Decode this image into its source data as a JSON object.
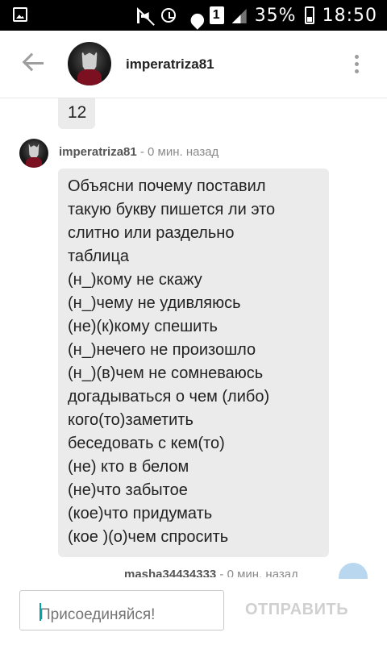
{
  "status_bar": {
    "sim_slot": "1",
    "battery": "35%",
    "time": "18:50",
    "icons": [
      "gallery-icon",
      "mute-icon",
      "alarm-icon",
      "wifi-icon",
      "sim-icon",
      "signal-icon",
      "battery-icon"
    ]
  },
  "header": {
    "username": "imperatriza81"
  },
  "previous_message": {
    "text": "12"
  },
  "message": {
    "author": "imperatriza81",
    "time": " - 0 мин. назад",
    "lines": [
      "Объясни почему поставил",
      "такую букву пишется ли это",
      "слитно или раздельно",
      "таблица",
      "(н_)кому не скажу",
      "(н_)чему не удивляюсь",
      "(не)(к)кому спешить",
      "(н_)нечего не произошло",
      "(н_)(в)чем не сомневаюсь",
      "догадываться о чем (либо)",
      "кого(то)заметить",
      "беседовать с кем(то)",
      "(не) кто в белом",
      "(не)что забытое",
      "(кое)что придумать",
      "(кое )(о)чем спросить"
    ]
  },
  "next_message": {
    "author": "masha34434333",
    "time": " - 0 мин. назад"
  },
  "composer": {
    "placeholder": "Присоединяйся!",
    "send_label": "ОТПРАВИТЬ"
  },
  "colors": {
    "accent": "#00a3a3",
    "bubble": "#ebebeb",
    "send_disabled": "#d0d0d0"
  }
}
